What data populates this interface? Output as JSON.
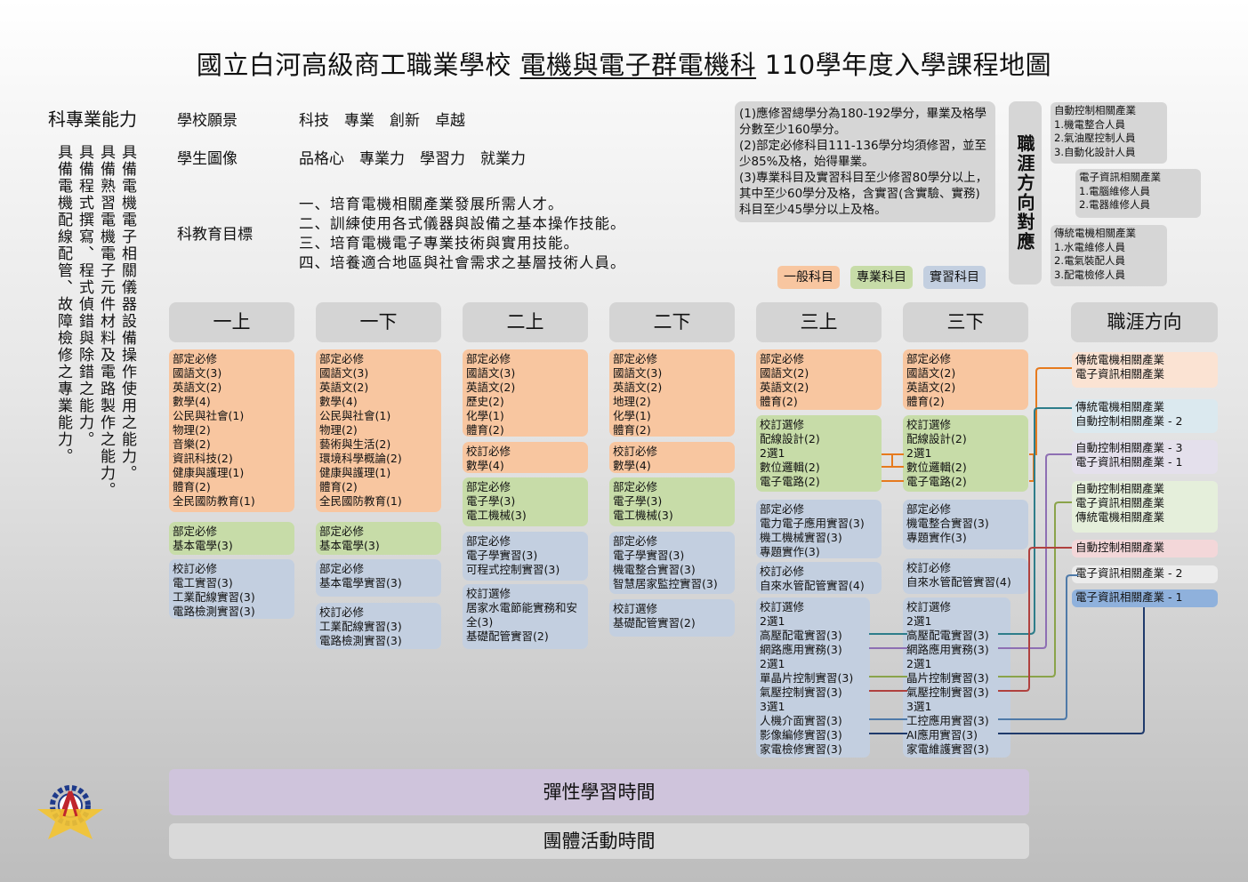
{
  "title": {
    "school": "國立白河高級商工職業學校",
    "dept": "電機與電子群電機科",
    "suffix": "110學年度入學課程地圖"
  },
  "abilities": {
    "heading": "科專業能力",
    "items": [
      "具備電機電子相關儀器設備操作使用之能力。",
      "具備熟習電機電子元件材料及電路製作之能力。",
      "具備程式撰寫、程式偵錯與除錯之能力。",
      "具備電機配線配管、故障檢修之專業能力。"
    ]
  },
  "vision": {
    "label": "學校願景",
    "value": "科技　專業　創新　卓越"
  },
  "portrait": {
    "label": "學生圖像",
    "value": "品格心　專業力　學習力　就業力"
  },
  "goals": {
    "label": "科教育目標",
    "items": [
      "一、培育電機相關產業發展所需人才。",
      "二、訓練使用各式儀器與設備之基本操作技能。",
      "三、培育電機電子專業技術與實用技能。",
      "四、培養適合地區與社會需求之基層技術人員。"
    ]
  },
  "notes": [
    "(1)應修習總學分為180-192學分，畢業及格學分數至少160學分。",
    "(2)部定必修科目111-136學分均須修習，並至少85%及格，始得畢業。",
    "(3)專業科目及實習科目至少修習80學分以上，其中至少60學分及格，含實習(含實驗、實務)科目至少45學分以上及格。"
  ],
  "legend": {
    "general": "一般科目",
    "professional": "專業科目",
    "practice": "實習科目"
  },
  "career_mapping_title": "職涯方向對應",
  "industry_boxes": [
    {
      "title": "自動控制相關產業",
      "items": [
        "1.機電整合人員",
        "2.氣油壓控制人員",
        "3.自動化設計人員"
      ]
    },
    {
      "title": "電子資訊相關產業",
      "items": [
        "1.電腦維修人員",
        "2.電器維修人員"
      ]
    },
    {
      "title": "傳統電機相關產業",
      "items": [
        "1.水電維修人員",
        "2.電氣裝配人員",
        "3.配電檢修人員"
      ]
    }
  ],
  "semesters": [
    "一上",
    "一下",
    "二上",
    "二下",
    "三上",
    "三下"
  ],
  "career_header": "職涯方向",
  "courses": {
    "s1": [
      {
        "color": "o",
        "lines": [
          "部定必修",
          "國語文(3)",
          "英語文(2)",
          "數學(4)",
          "公民與社會(1)",
          "物理(2)",
          "音樂(2)",
          "資訊科技(2)",
          "健康與護理(1)",
          "體育(2)",
          "全民國防教育(1)"
        ]
      },
      {
        "color": "g",
        "lines": [
          "部定必修",
          "基本電學(3)"
        ]
      },
      {
        "color": "b",
        "lines": [
          "校訂必修",
          "電工實習(3)",
          "工業配線實習(3)",
          "電路檢測實習(3)"
        ]
      }
    ],
    "s2": [
      {
        "color": "o",
        "lines": [
          "部定必修",
          "國語文(3)",
          "英語文(2)",
          "數學(4)",
          "公民與社會(1)",
          "物理(2)",
          "藝術與生活(2)",
          "環境科學概論(2)",
          "健康與護理(1)",
          "體育(2)",
          "全民國防教育(1)"
        ]
      },
      {
        "color": "g",
        "lines": [
          "部定必修",
          "基本電學(3)"
        ]
      },
      {
        "color": "b",
        "lines": [
          "部定必修",
          "基本電學實習(3)"
        ]
      },
      {
        "color": "b",
        "lines": [
          "校訂必修",
          "工業配線實習(3)",
          "電路檢測實習(3)"
        ]
      }
    ],
    "s3": [
      {
        "color": "o",
        "lines": [
          "部定必修",
          "國語文(3)",
          "英語文(2)",
          "歷史(2)",
          "化學(1)",
          "體育(2)"
        ]
      },
      {
        "color": "o",
        "lines": [
          "校訂必修",
          "數學(4)"
        ]
      },
      {
        "color": "g",
        "lines": [
          "部定必修",
          "電子學(3)",
          "電工機械(3)"
        ]
      },
      {
        "color": "b",
        "lines": [
          "部定必修",
          "電子學實習(3)",
          "可程式控制實習(3)"
        ]
      },
      {
        "color": "b",
        "lines": [
          "校訂選修",
          "居家水電節能實務和安",
          "全(3)",
          "基礎配管實習(2)"
        ]
      }
    ],
    "s4": [
      {
        "color": "o",
        "lines": [
          "部定必修",
          "國語文(3)",
          "英語文(2)",
          "地理(2)",
          "化學(1)",
          "體育(2)"
        ]
      },
      {
        "color": "o",
        "lines": [
          "校訂必修",
          "數學(4)"
        ]
      },
      {
        "color": "g",
        "lines": [
          "部定必修",
          "電子學(3)",
          "電工機械(3)"
        ]
      },
      {
        "color": "b",
        "lines": [
          "部定必修",
          "電子學實習(3)",
          "機電整合實習(3)",
          "智慧居家監控實習(3)"
        ]
      },
      {
        "color": "b",
        "lines": [
          "校訂選修",
          "基礎配管實習(2)"
        ]
      }
    ],
    "s5": [
      {
        "color": "o",
        "lines": [
          "部定必修",
          "國語文(2)",
          "英語文(2)",
          "體育(2)"
        ]
      },
      {
        "color": "g",
        "lines": [
          "校訂選修",
          "配線設計(2)",
          "2選1",
          "數位邏輯(2)",
          "電子電路(2)"
        ]
      },
      {
        "color": "b",
        "lines": [
          "部定必修",
          "電力電子應用實習(3)",
          "機工機械實習(3)",
          "專題實作(3)"
        ]
      },
      {
        "color": "b",
        "lines": [
          "校訂必修",
          "自來水管配管實習(4)"
        ]
      },
      {
        "color": "b",
        "lines": [
          "校訂選修",
          "2選1",
          "高壓配電實習(3)",
          "網路應用實務(3)",
          "2選1",
          "單晶片控制實習(3)",
          "氣壓控制實習(3)",
          "3選1",
          "人機介面實習(3)",
          "影像編修實習(3)",
          "家電檢修實習(3)"
        ]
      }
    ],
    "s6": [
      {
        "color": "o",
        "lines": [
          "部定必修",
          "國語文(2)",
          "英語文(2)",
          "體育(2)"
        ]
      },
      {
        "color": "g",
        "lines": [
          "校訂選修",
          "配線設計(2)",
          "2選1",
          "數位邏輯(2)",
          "電子電路(2)"
        ]
      },
      {
        "color": "b",
        "lines": [
          "部定必修",
          "機電整合實習(3)",
          "專題實作(3)"
        ]
      },
      {
        "color": "b",
        "lines": [
          "校訂必修",
          "自來水管配管實習(4)"
        ]
      },
      {
        "color": "b",
        "lines": [
          "校訂選修",
          "2選1",
          "高壓配電實習(3)",
          "網路應用實務(3)",
          "2選1",
          "晶片控制實習(3)",
          "氣壓控制實習(3)",
          "3選1",
          "工控應用實習(3)",
          "AI應用實習(3)",
          "家電維護實習(3)"
        ]
      }
    ]
  },
  "careers": [
    {
      "lines": [
        "傳統電機相關產業",
        "電子資訊相關產業"
      ],
      "bg": "#fbe3d3"
    },
    {
      "lines": [
        "傳統電機相關產業",
        "自動控制相關產業 - 2"
      ],
      "bg": "#dbe9ef"
    },
    {
      "lines": [
        "自動控制相關產業 - 3",
        "電子資訊相關產業 - 1"
      ],
      "bg": "#e4e0ec"
    },
    {
      "lines": [
        "自動控制相關產業",
        "電子資訊相關產業",
        "傳統電機相關產業"
      ],
      "bg": "#e5efdb"
    },
    {
      "lines": [
        "自動控制相關產業"
      ],
      "bg": "#f3d7d9"
    },
    {
      "lines": [
        "電子資訊相關產業 - 2"
      ],
      "bg": "#ececec"
    },
    {
      "lines": [
        "電子資訊相關產業 - 1"
      ],
      "bg": "#8fb1dc"
    }
  ],
  "flex_time": "彈性學習時間",
  "group_time": "團體活動時間",
  "colors": {
    "orange": "#f8c6a0",
    "green": "#c7dca8",
    "blue": "#c3cfe0",
    "line_orange": "#e67a1e",
    "line_teal": "#2e7d8a",
    "line_purple": "#8e6fb3",
    "line_olive": "#8aa34a",
    "line_red": "#b0413e",
    "line_steel": "#4f7aa8",
    "line_navy": "#1f3a6b"
  }
}
